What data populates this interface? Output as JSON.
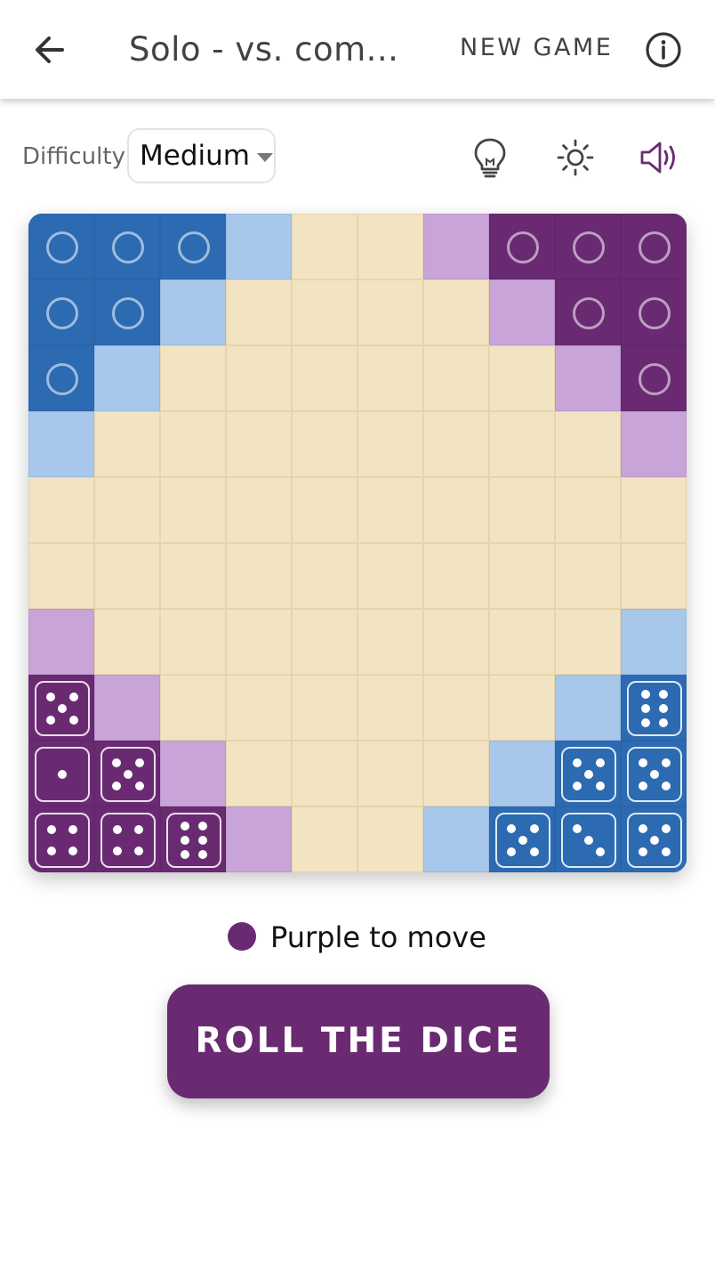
{
  "header": {
    "title": "Solo - vs. com...",
    "new_game_label": "NEW GAME"
  },
  "icons": {
    "back": "arrow-left-icon",
    "info": "info-icon",
    "hint": "lightbulb-icon",
    "theme": "sun-icon",
    "sound": "volume-icon"
  },
  "difficulty": {
    "label": "Difficulty",
    "selected": "Medium"
  },
  "colors": {
    "purple": "#6a2a72",
    "blue": "#2c6ab1",
    "light_purple": "#c8a4d9",
    "light_blue": "#a7c7eb",
    "beige": "#f2e3c3"
  },
  "board": {
    "rows": [
      [
        "B",
        "B",
        "B",
        "b",
        "e",
        "e",
        "p",
        "P",
        "P",
        "P"
      ],
      [
        "B",
        "B",
        "b",
        "e",
        "e",
        "e",
        "e",
        "p",
        "P",
        "P"
      ],
      [
        "B",
        "b",
        "e",
        "e",
        "e",
        "e",
        "e",
        "e",
        "p",
        "P"
      ],
      [
        "b",
        "e",
        "e",
        "e",
        "e",
        "e",
        "e",
        "e",
        "e",
        "p"
      ],
      [
        "e",
        "e",
        "e",
        "e",
        "e",
        "e",
        "e",
        "e",
        "e",
        "e"
      ],
      [
        "e",
        "e",
        "e",
        "e",
        "e",
        "e",
        "e",
        "e",
        "e",
        "e"
      ],
      [
        "p",
        "e",
        "e",
        "e",
        "e",
        "e",
        "e",
        "e",
        "e",
        "b"
      ],
      [
        "P",
        "p",
        "e",
        "e",
        "e",
        "e",
        "e",
        "e",
        "b",
        "B"
      ],
      [
        "P",
        "P",
        "p",
        "e",
        "e",
        "e",
        "e",
        "b",
        "B",
        "B"
      ],
      [
        "P",
        "P",
        "P",
        "p",
        "e",
        "e",
        "b",
        "B",
        "B",
        "B"
      ]
    ],
    "rings": [
      [
        0,
        0
      ],
      [
        0,
        1
      ],
      [
        0,
        2
      ],
      [
        1,
        0
      ],
      [
        1,
        1
      ],
      [
        2,
        0
      ],
      [
        0,
        7
      ],
      [
        0,
        8
      ],
      [
        0,
        9
      ],
      [
        1,
        8
      ],
      [
        1,
        9
      ],
      [
        2,
        9
      ]
    ],
    "dice": [
      {
        "r": 7,
        "c": 0,
        "v": 5
      },
      {
        "r": 8,
        "c": 0,
        "v": 1
      },
      {
        "r": 8,
        "c": 1,
        "v": 5
      },
      {
        "r": 9,
        "c": 0,
        "v": 4
      },
      {
        "r": 9,
        "c": 1,
        "v": 4
      },
      {
        "r": 9,
        "c": 2,
        "v": 6
      },
      {
        "r": 7,
        "c": 9,
        "v": 6
      },
      {
        "r": 8,
        "c": 8,
        "v": 5
      },
      {
        "r": 8,
        "c": 9,
        "v": 5
      },
      {
        "r": 9,
        "c": 7,
        "v": 5
      },
      {
        "r": 9,
        "c": 8,
        "v": 3
      },
      {
        "r": 9,
        "c": 9,
        "v": 5
      }
    ]
  },
  "status": {
    "text": "Purple to move"
  },
  "roll_button": {
    "label": "ROLL THE DICE"
  }
}
